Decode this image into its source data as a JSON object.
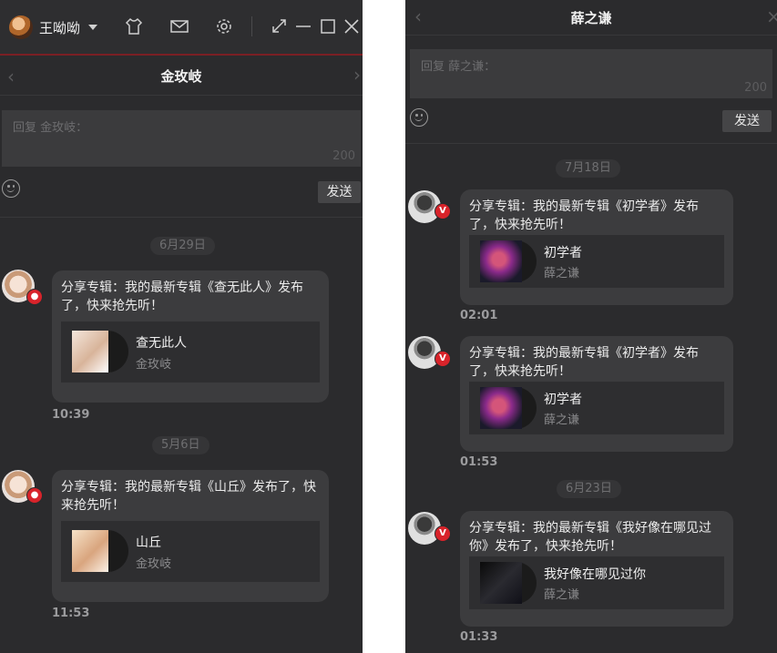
{
  "left": {
    "user": {
      "name": "王呦呦"
    },
    "toolbar_icons": [
      "tshirt-icon",
      "mail-icon",
      "gear-icon",
      "miniwindow-icon",
      "minimize-icon",
      "maximize-icon",
      "close-icon"
    ],
    "chat": {
      "title": "金玫岐",
      "reply_placeholder": "回复 金玫岐：",
      "char_count": "200",
      "send_label": "发送",
      "messages": [
        {
          "date": "6月29日",
          "line1": "分享专辑：我的最新专辑《查无此人》发布",
          "line2": "了，快来抢先听！",
          "album": "查无此人",
          "artist": "金玫岐",
          "time": "10:39"
        },
        {
          "date": "5月6日",
          "line1": "分享专辑：我的最新专辑《山丘》发布了，快",
          "line2": "来抢先听！",
          "album": "山丘",
          "artist": "金玫岐",
          "time": "11:53"
        }
      ]
    }
  },
  "right": {
    "chat": {
      "title": "薛之谦",
      "reply_placeholder": "回复 薛之谦：",
      "char_count": "200",
      "send_label": "发送",
      "messages": [
        {
          "date": "7月18日",
          "line1": "分享专辑：我的最新专辑《初学者》发布",
          "line2": "了，快来抢先听！",
          "album": "初学者",
          "artist": "薛之谦",
          "time": "02:01"
        },
        {
          "date": "",
          "line1": "分享专辑：我的最新专辑《初学者》发布",
          "line2": "了，快来抢先听！",
          "album": "初学者",
          "artist": "薛之谦",
          "time": "01:53"
        },
        {
          "date": "6月23日",
          "line1": "分享专辑：我的最新专辑《我好像在哪见过",
          "line2": "你》发布了，快来抢先听！",
          "album": "我好像在哪见过你",
          "artist": "薛之谦",
          "time": "01:33"
        }
      ]
    }
  },
  "colors": {
    "panel_bg": "#2b2b2d",
    "bubble_bg": "#3c3c3e",
    "badge_red": "#d8232a",
    "accent_line": "#7a1f24"
  }
}
